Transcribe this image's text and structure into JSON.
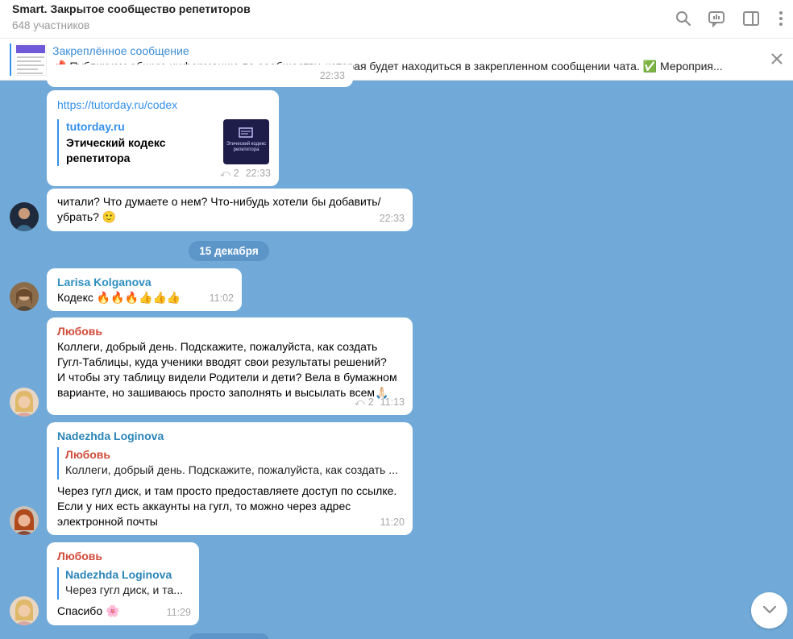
{
  "header": {
    "title": "Smart. Закрытое сообщество репетиторов",
    "subtitle": "648 участников"
  },
  "pinned": {
    "title": "Закреплённое сообщение",
    "text": "📌 Публикуем общую информацию по сообществу, которая будет находиться в закрепленном сообщении чата. ✅ Мероприя..."
  },
  "messages": {
    "m0": {
      "time": "22:33"
    },
    "m1": {
      "link": "https://tutorday.ru/codex",
      "site": "tutorday.ru",
      "preview_title_1": "Этический кодекс",
      "preview_title_2": "репетитора",
      "thumb_label": "Этический кодекс репетитора",
      "replies": "2",
      "time": "22:33"
    },
    "m2": {
      "line1": "читали? Что думаете о нем? Что-нибудь хотели бы добавить/",
      "line2": "убрать? 🙂",
      "time": "22:33"
    },
    "date_separator": "15 декабря",
    "m3": {
      "sender": "Larisa Kolganova",
      "text": "Кодекс 🔥🔥🔥👍👍👍",
      "time": "11:02"
    },
    "m4": {
      "sender": "Любовь",
      "line1": "Коллеги, добрый день. Подскажите, пожалуйста, как создать",
      "line2": "Гугл-Таблицы, куда ученики вводят свои результаты решений?",
      "line3": "И чтобы эту таблицу видели Родители и дети? Вела в бумажном",
      "line4": "варианте, но зашиваюсь просто заполнять и высылать всем🙏🏻",
      "replies": "2",
      "time": "11:13"
    },
    "m5": {
      "sender": "Nadezhda Loginova",
      "quote_name": "Любовь",
      "quote_text": "Коллеги, добрый день. Подскажите, пожалуйста, как создать ...",
      "line1": "Через гугл диск, и там просто предоставляете доступ по ссылке.",
      "line2": "Если у них есть аккаунты на гугл, то можно через адрес",
      "line3": "электронной почты",
      "time": "11:20"
    },
    "m6": {
      "sender": "Любовь",
      "quote_name": "Nadezhda Loginova",
      "quote_text": "Через гугл диск, и та...",
      "text": "Спасибо 🌸",
      "time": "11:29"
    }
  },
  "icons": {
    "search": "search-icon",
    "chat_info": "chat-info-icon",
    "sidebar": "sidebar-icon",
    "more": "more-icon",
    "close": "close-icon",
    "reply": "reply-icon",
    "scroll_down": "chevron-down-icon"
  },
  "colors": {
    "chat_bg": "#71aad8",
    "accent": "#3390ec",
    "sender_larisa": "#2d8fc0",
    "sender_lubov": "#d14c3b",
    "sender_nadezhda": "#2a85b8"
  }
}
